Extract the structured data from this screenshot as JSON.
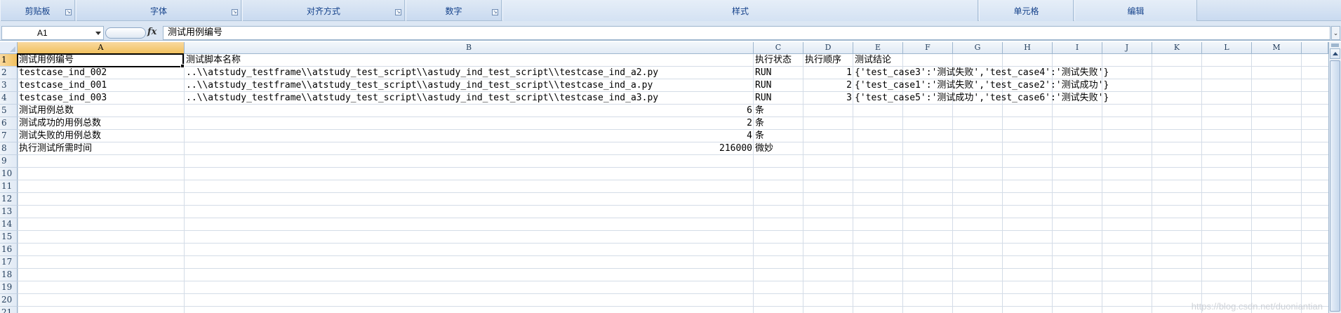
{
  "ribbon": {
    "groups": [
      {
        "label": "剪贴板",
        "launcher": true
      },
      {
        "label": "字体",
        "launcher": true
      },
      {
        "label": "对齐方式",
        "launcher": true
      },
      {
        "label": "数字",
        "launcher": true
      },
      {
        "label": "样式",
        "launcher": false
      },
      {
        "label": "单元格",
        "launcher": false
      },
      {
        "label": "编辑",
        "launcher": false
      }
    ]
  },
  "formula_bar": {
    "name_box": "A1",
    "fx_label": "fx",
    "content": "测试用例编号"
  },
  "columns": [
    "A",
    "B",
    "C",
    "D",
    "E",
    "F",
    "G",
    "H",
    "I",
    "J",
    "K",
    "L",
    "M"
  ],
  "selected_column": "A",
  "rows": [
    "1",
    "2",
    "3",
    "4",
    "5",
    "6",
    "7",
    "8",
    "9",
    "10",
    "11",
    "12",
    "13",
    "14",
    "15",
    "16",
    "17",
    "18",
    "19",
    "20",
    "21"
  ],
  "selected_row": "1",
  "cells": {
    "r1": {
      "A": "测试用例编号",
      "B": "测试脚本名称",
      "C": "执行状态",
      "D": "执行顺序",
      "E": "测试结论"
    },
    "r2": {
      "A": "testcase_ind_002",
      "B": "..\\\\atstudy_testframe\\\\atstudy_test_script\\\\astudy_ind_test_script\\\\testcase_ind_a2.py",
      "C": "RUN",
      "D": "1",
      "E": "{'test_case3':'测试失败','test_case4':'测试失败'}"
    },
    "r3": {
      "A": "testcase_ind_001",
      "B": "..\\\\atstudy_testframe\\\\atstudy_test_script\\\\astudy_ind_test_script\\\\testcase_ind_a.py",
      "C": "RUN",
      "D": "2",
      "E": "{'test_case1':'测试失败','test_case2':'测试成功'}"
    },
    "r4": {
      "A": "testcase_ind_003",
      "B": "..\\\\atstudy_testframe\\\\atstudy_test_script\\\\astudy_ind_test_script\\\\testcase_ind_a3.py",
      "C": "RUN",
      "D": "3",
      "E": "{'test_case5':'测试成功','test_case6':'测试失败'}"
    },
    "r5": {
      "A": "测试用例总数",
      "B": "6",
      "C": "条"
    },
    "r6": {
      "A": "测试成功的用例总数",
      "B": "2",
      "C": "条"
    },
    "r7": {
      "A": "测试失败的用例总数",
      "B": "4",
      "C": "条"
    },
    "r8": {
      "A": "执行测试所需时间",
      "B": "216000",
      "C": "微妙"
    }
  },
  "watermark": "https://blog.csdn.net/duoniantian"
}
